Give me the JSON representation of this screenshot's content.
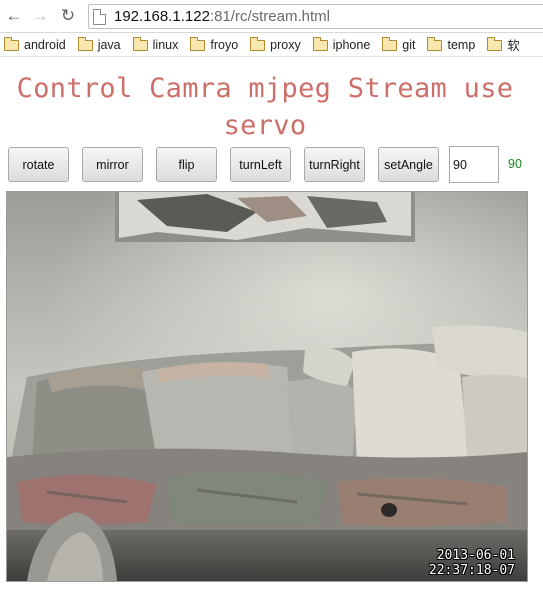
{
  "browser": {
    "url_host": "192.168.1.122",
    "url_rest": ":81/rc/stream.html",
    "bookmarks": [
      "android",
      "java",
      "linux",
      "froyo",
      "proxy",
      "iphone",
      "git",
      "temp",
      "软"
    ]
  },
  "page": {
    "title": "Control Camra mjpeg Stream use servo"
  },
  "controls": {
    "rotate": "rotate",
    "mirror": "mirror",
    "flip": "flip",
    "turn_left": "turnLeft",
    "turn_right": "turnRight",
    "set_angle": "setAngle",
    "angle_value": "90",
    "angle_readout": "90"
  },
  "stream": {
    "date": "2013-06-01",
    "time": "22:37:18-07"
  }
}
